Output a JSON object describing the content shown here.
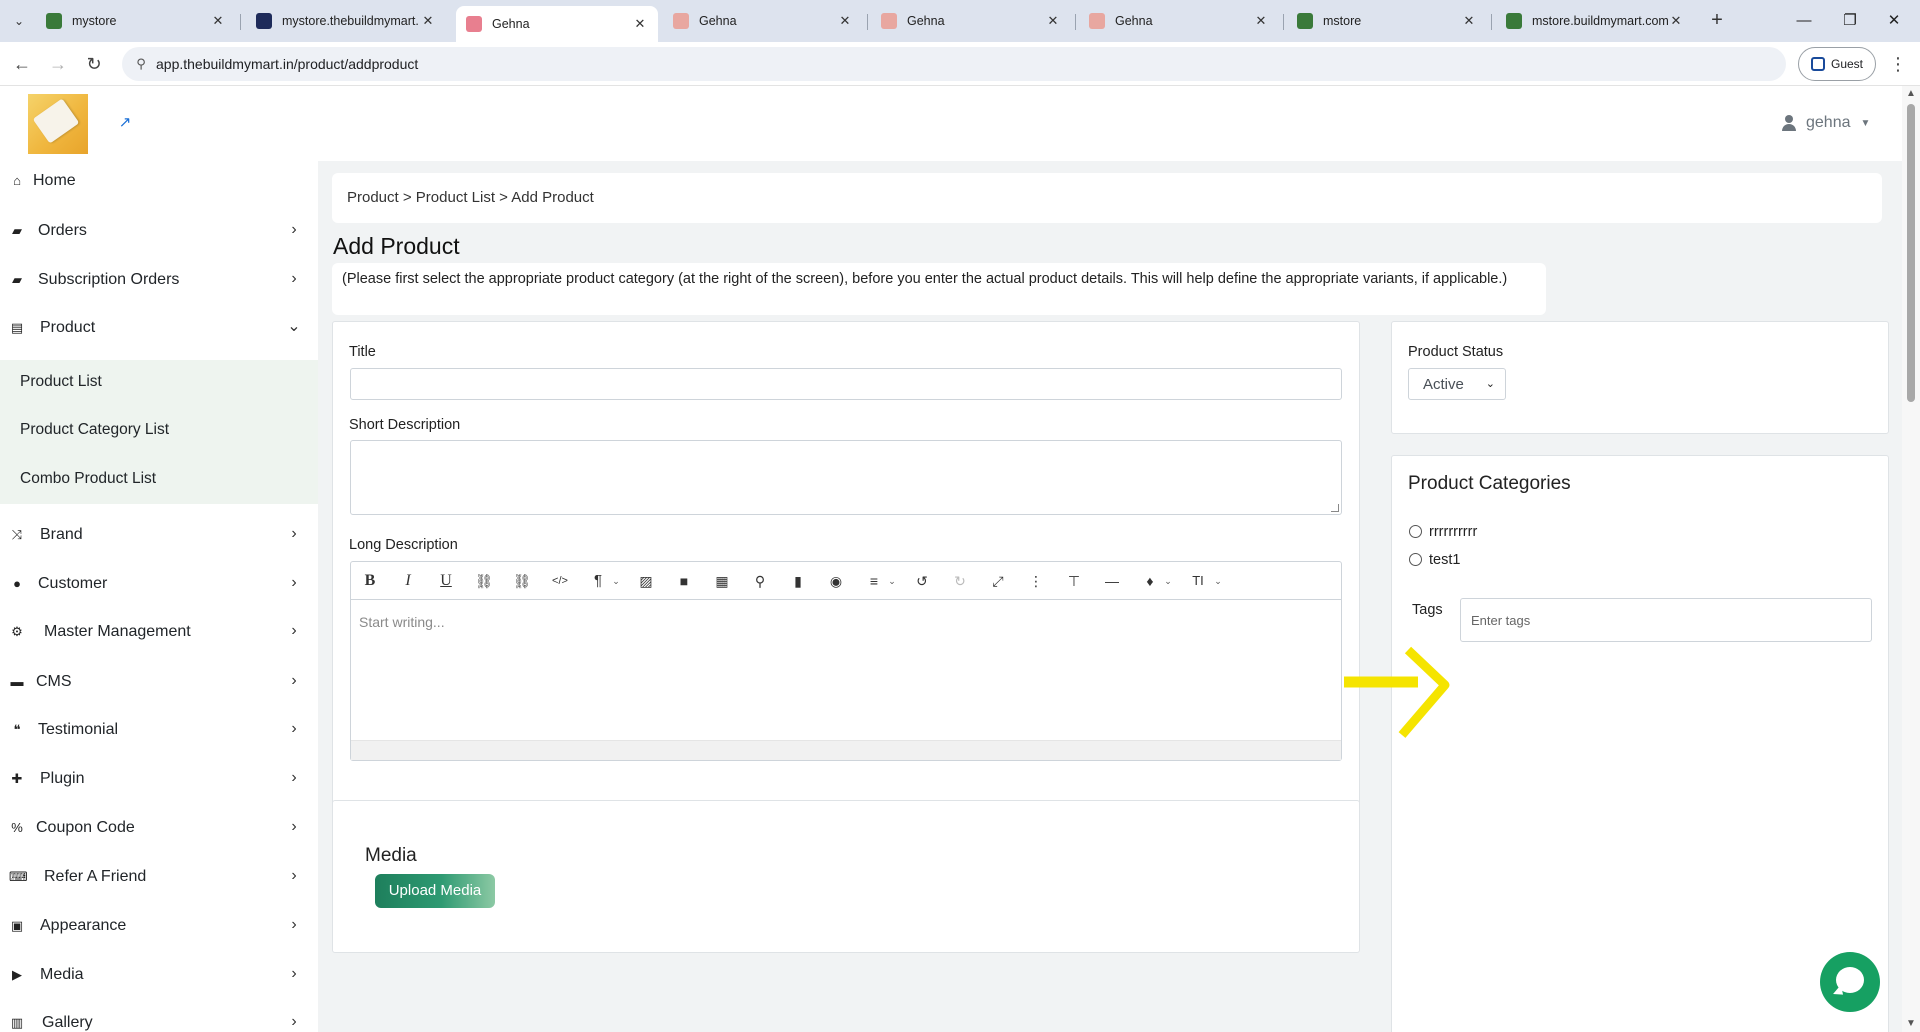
{
  "browser": {
    "tabs": [
      {
        "label": "mystore",
        "color": "#3a7a3a"
      },
      {
        "label": "mystore.thebuildmymart.",
        "color": "#1e2b5a"
      },
      {
        "label": "Gehna",
        "color": "#e87f8f"
      },
      {
        "label": "Gehna",
        "color": "#e8a7a0"
      },
      {
        "label": "Gehna",
        "color": "#e8a7a0"
      },
      {
        "label": "Gehna",
        "color": "#e8a7a0"
      },
      {
        "label": "mstore",
        "color": "#3a7a3a"
      },
      {
        "label": "mstore.buildmymart.com",
        "color": "#3a7a3a"
      }
    ],
    "active_tab": 2,
    "url": "app.thebuildmymart.in/product/addproduct",
    "profile_label": "Guest"
  },
  "header": {
    "user_name": "gehna"
  },
  "sidebar": {
    "items": [
      {
        "label": "Home",
        "icon": "home-icon",
        "glyph": "⌂"
      },
      {
        "label": "Orders",
        "icon": "bag-icon",
        "glyph": "▰"
      },
      {
        "label": "Subscription Orders",
        "icon": "bag-icon",
        "glyph": "▰"
      },
      {
        "label": "Product",
        "icon": "box-icon",
        "glyph": "▤"
      },
      {
        "label": "Brand",
        "icon": "shuffle-icon",
        "glyph": "⤨"
      },
      {
        "label": "Customer",
        "icon": "user-icon",
        "glyph": "●"
      },
      {
        "label": "Master Management",
        "icon": "user-gear-icon",
        "glyph": "⚙"
      },
      {
        "label": "CMS",
        "icon": "file-icon",
        "glyph": "▬"
      },
      {
        "label": "Testimonial",
        "icon": "quote-icon",
        "glyph": "❝"
      },
      {
        "label": "Plugin",
        "icon": "puzzle-icon",
        "glyph": "✚"
      },
      {
        "label": "Coupon Code",
        "icon": "percent-icon",
        "glyph": "%"
      },
      {
        "label": "Refer A Friend",
        "icon": "keyboard-icon",
        "glyph": "⌨"
      },
      {
        "label": "Appearance",
        "icon": "image-icon",
        "glyph": "▣"
      },
      {
        "label": "Media",
        "icon": "play-circle-icon",
        "glyph": "▶"
      },
      {
        "label": "Gallery",
        "icon": "images-icon",
        "glyph": "▥"
      }
    ],
    "product_subitems": [
      "Product List",
      "Product Category List",
      "Combo Product List"
    ]
  },
  "main": {
    "breadcrumb": "Product > Product List > Add Product",
    "page_title": "Add Product",
    "note": "(Please first select the appropriate product category (at the right of the screen), before you enter the actual product details. This will help define the appropriate variants, if applicable.)",
    "title_label": "Title",
    "title_value": "",
    "short_description_label": "Short Description",
    "short_description_value": "",
    "long_description_label": "Long Description",
    "editor_placeholder": "Start writing...",
    "media_title": "Media",
    "upload_label": "Upload Media"
  },
  "right": {
    "status_label": "Product Status",
    "status_value": "Active",
    "categories_title": "Product Categories",
    "categories": [
      "rrrrrrrrrr",
      "test1"
    ],
    "tags_label": "Tags",
    "tags_placeholder": "Enter tags"
  },
  "colors": {
    "accent_green": "#1e7f5c",
    "chat_green": "#16a062",
    "annotation_yellow": "#f5e400"
  }
}
